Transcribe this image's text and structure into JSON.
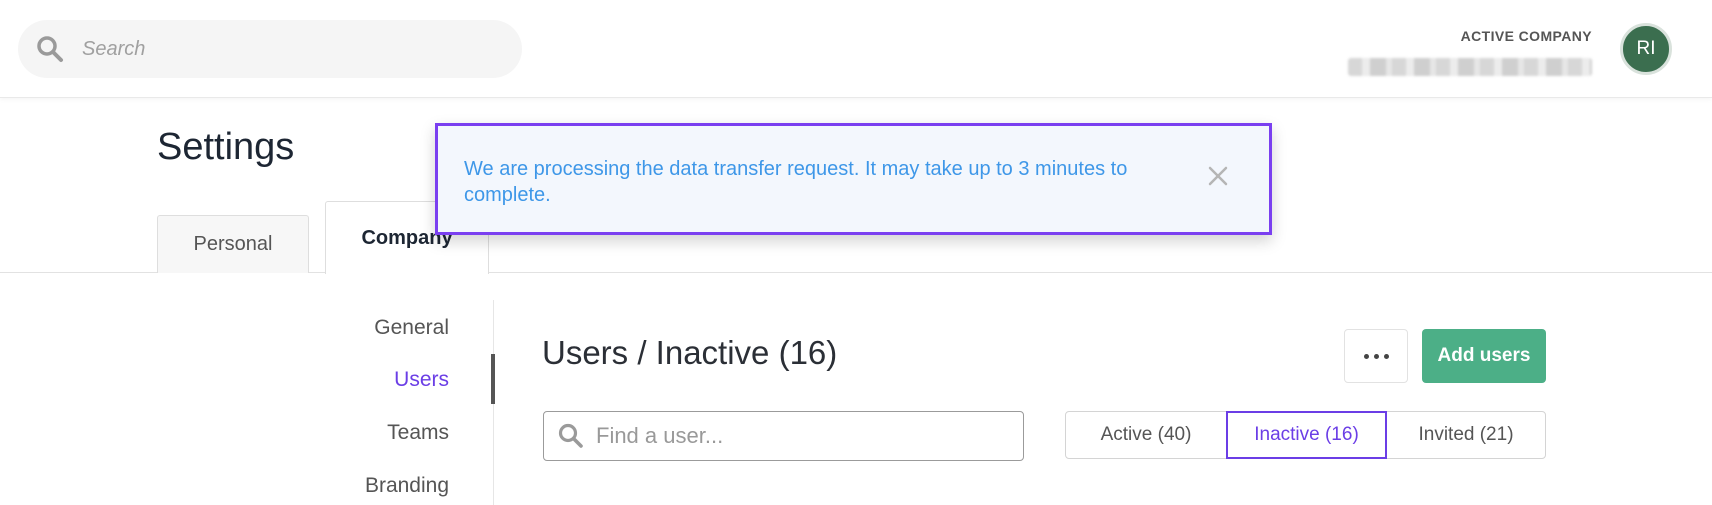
{
  "header": {
    "search_placeholder": "Search",
    "active_company_label": "ACTIVE COMPANY",
    "avatar_initials": "RI"
  },
  "page": {
    "title": "Settings",
    "tabs": [
      {
        "label": "Personal"
      },
      {
        "label": "Company"
      }
    ]
  },
  "sidebar": {
    "items": [
      {
        "label": "General"
      },
      {
        "label": "Users"
      },
      {
        "label": "Teams"
      },
      {
        "label": "Branding"
      }
    ]
  },
  "main": {
    "title": "Users / Inactive (16)",
    "more_icon": "more-horizontal-icon",
    "add_button_label": "Add users",
    "find_placeholder": "Find a user...",
    "filters": [
      {
        "label": "Active (40)"
      },
      {
        "label": "Inactive (16)"
      },
      {
        "label": "Invited (21)"
      }
    ]
  },
  "toast": {
    "message": "We are processing the data transfer request. It may take up to 3 minutes to complete.",
    "close_icon": "close-icon"
  },
  "colors": {
    "accent": "#6b3ee6",
    "primary_button": "#4caf87",
    "toast_text": "#3e97e8",
    "toast_border": "#7a3ff0",
    "avatar_bg": "#3b6e4f"
  }
}
